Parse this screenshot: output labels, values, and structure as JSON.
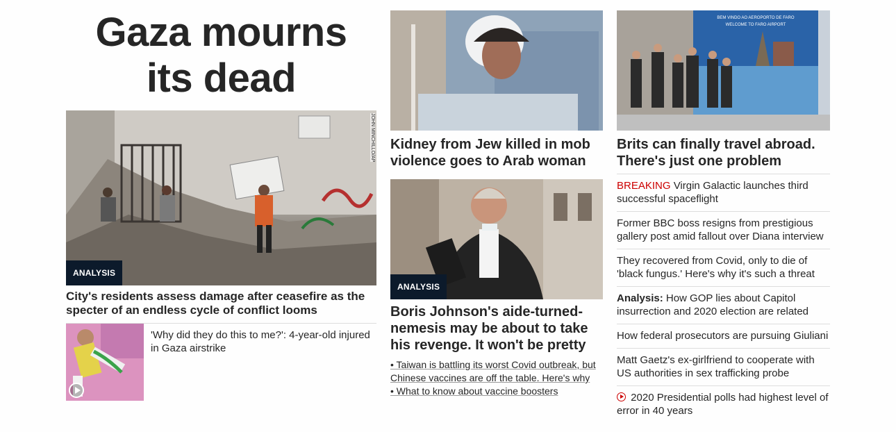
{
  "colors": {
    "breaking": "#cc0000",
    "tag_bg": "#0c1a2b",
    "text": "#262626",
    "divider": "#dddddd"
  },
  "lead": {
    "headline_line1": "Gaza mourns",
    "headline_line2": "its dead",
    "tag": "ANALYSIS",
    "photo_credit": "JOHN MINCHILLO/AP",
    "caption": "City's residents assess damage after ceasefire as the specter of an endless cycle of conflict looms",
    "secondary_story": "'Why did they do this to me?': 4-year-old injured in Gaza airstrike",
    "secondary_icon": "play-icon"
  },
  "middle": {
    "story1": "Kidney from Jew killed in mob violence goes to Arab woman",
    "story2_tag": "ANALYSIS",
    "story2": "Boris Johnson's aide-turned-nemesis may be about to take his revenge. It won't be pretty",
    "bullets": [
      "• Taiwan is battling its worst Covid outbreak, but Chinese vaccines are off the table. Here's why",
      "• What to know about vaccine boosters"
    ]
  },
  "right": {
    "headline": "Brits can finally travel abroad. There's just one problem",
    "image_sign_line1": "BEM VINDO AO AEROPORTO DE FARO",
    "image_sign_line2": "WELCOME TO FARO AIRPORT",
    "list": [
      {
        "prefix": "BREAKING",
        "text": " Virgin Galactic launches third successful spaceflight"
      },
      {
        "text": "Former BBC boss resigns from prestigious gallery post amid fallout over Diana interview"
      },
      {
        "text": "They recovered from Covid, only to die of 'black fungus.' Here's why it's such a threat"
      },
      {
        "prefix": "Analysis:",
        "text": " How GOP lies about Capitol insurrection and 2020 election are related"
      },
      {
        "text": "How federal prosecutors are pursuing Giuliani"
      },
      {
        "text": "Matt Gaetz's ex-girlfriend to cooperate with US authorities in sex trafficking probe"
      },
      {
        "icon": "play-icon",
        "text": " 2020 Presidential polls had highest level of error in 40 years"
      }
    ]
  }
}
